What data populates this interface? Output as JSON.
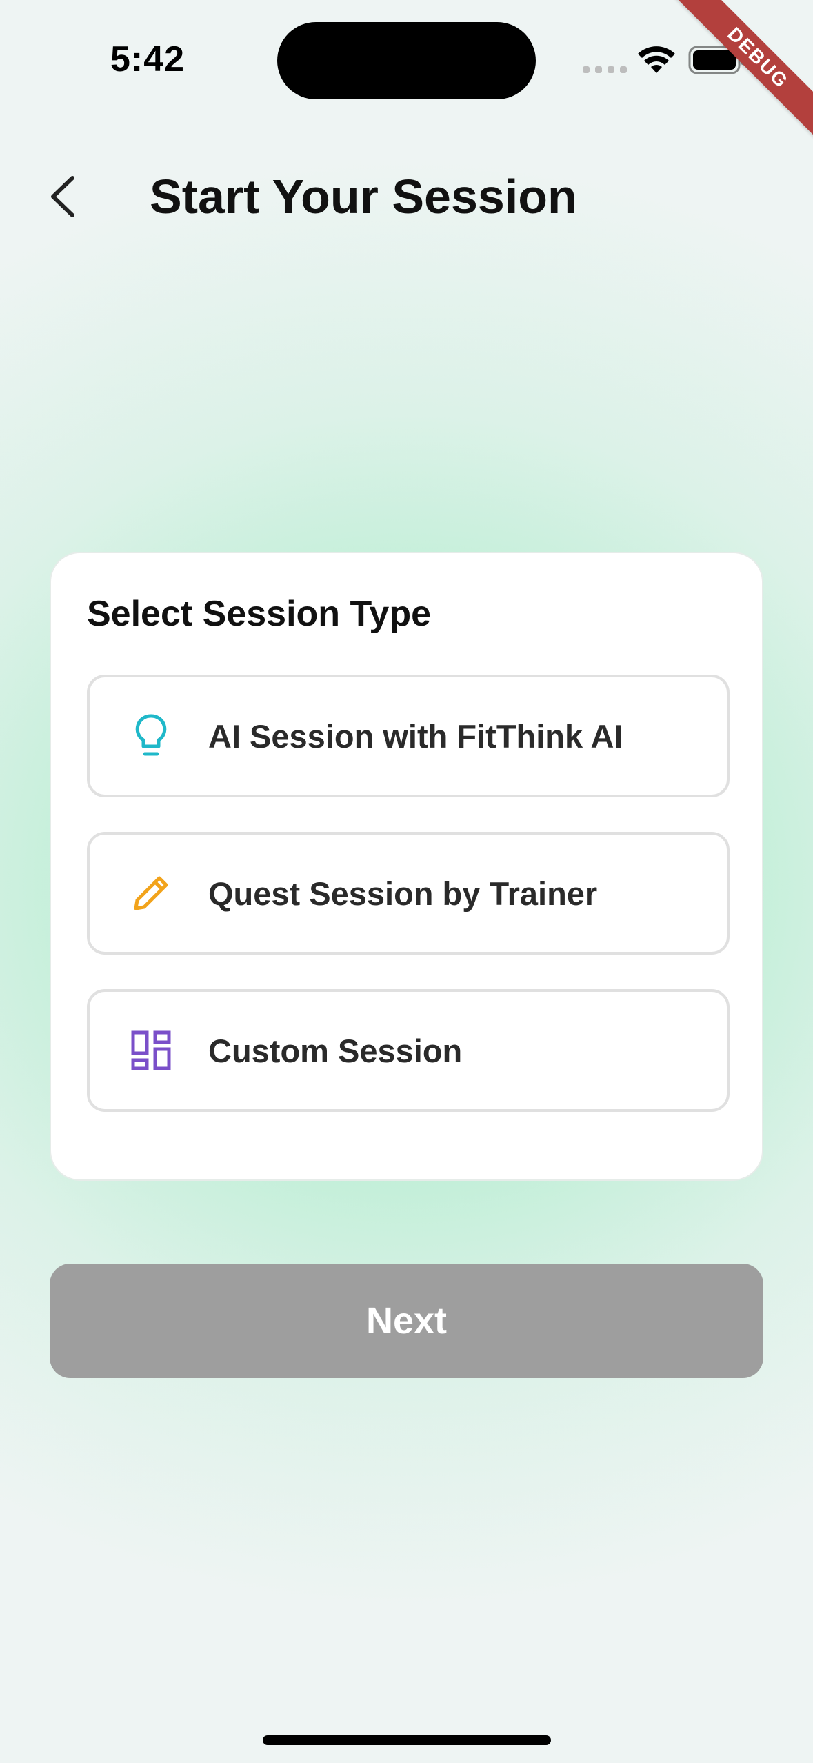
{
  "status_bar": {
    "time": "5:42"
  },
  "debug_banner": "DEBUG",
  "header": {
    "title": "Start Your Session",
    "back_icon": "chevron-left-icon"
  },
  "card": {
    "title": "Select Session Type",
    "options": [
      {
        "label": "AI Session with FitThink AI",
        "icon": "lightbulb-icon",
        "icon_color": "#1fb8c9"
      },
      {
        "label": "Quest Session by Trainer",
        "icon": "pencil-icon",
        "icon_color": "#f2a31b"
      },
      {
        "label": "Custom Session",
        "icon": "dashboard-icon",
        "icon_color": "#7a4fc9"
      }
    ]
  },
  "next_button": {
    "label": "Next",
    "state": "disabled",
    "color": "#9e9e9e"
  },
  "colors": {
    "background_accent": "#9ee6c1",
    "card_background": "#ffffff"
  }
}
